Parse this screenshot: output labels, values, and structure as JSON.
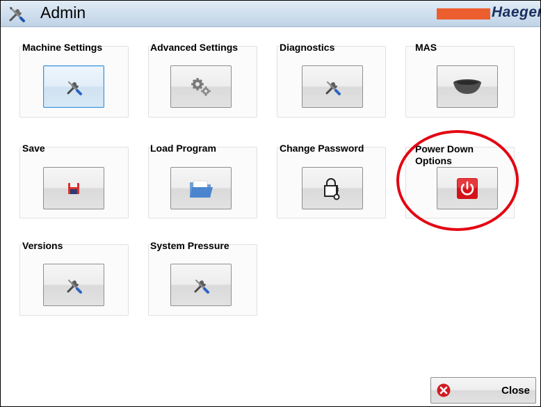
{
  "window": {
    "title": "Admin",
    "brand": "Haeger"
  },
  "tiles": {
    "machine_settings": {
      "label": "Machine Settings",
      "icon": "tools-icon"
    },
    "advanced_settings": {
      "label": "Advanced Settings",
      "icon": "gears-icon"
    },
    "diagnostics": {
      "label": "Diagnostics",
      "icon": "tools-icon"
    },
    "mas": {
      "label": "MAS",
      "icon": "bowl-icon"
    },
    "save": {
      "label": "Save",
      "icon": "floppy-disk-icon"
    },
    "load_program": {
      "label": "Load Program",
      "icon": "folder-icon"
    },
    "change_password": {
      "label": "Change Password",
      "icon": "lock-key-icon"
    },
    "power_down": {
      "label_line1": "Power Down",
      "label_line2": "Options",
      "icon": "power-icon"
    },
    "versions": {
      "label": "Versions",
      "icon": "tools-icon"
    },
    "system_pressure": {
      "label": "System Pressure",
      "icon": "tools-icon"
    }
  },
  "footer": {
    "close_label": "Close",
    "close_icon": "close-x-icon"
  },
  "colors": {
    "brand_bar": "#ec5e2e",
    "brand_text": "#1b2f60",
    "annotation_circle": "#e30613",
    "selected_border": "#3c93d8"
  }
}
